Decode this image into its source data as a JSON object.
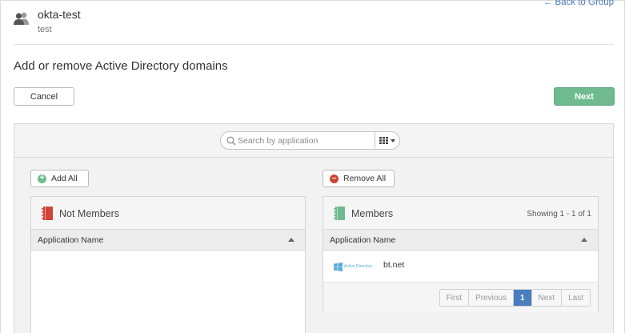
{
  "header": {
    "back_link": "← Back to Group",
    "group_name": "okta-test",
    "group_description": "test",
    "group_icon": "group-icon"
  },
  "page": {
    "title": "Add or remove Active Directory domains"
  },
  "buttons": {
    "cancel": "Cancel",
    "next": "Next"
  },
  "search": {
    "placeholder": "Search by application",
    "value": "",
    "view_toggle_icon": "grid-view-icon"
  },
  "actions": {
    "add_all": "Add All",
    "remove_all": "Remove All"
  },
  "not_members": {
    "title": "Not Members",
    "icon": "app-book-icon",
    "icon_color": "#d04437",
    "columns": [
      "Application Name"
    ],
    "rows": []
  },
  "members": {
    "title": "Members",
    "icon": "app-book-icon",
    "icon_color": "#6fba8e",
    "showing": "Showing 1 - 1 of 1",
    "columns": [
      "Application Name"
    ],
    "rows": [
      {
        "logo": "Active Directory",
        "name": "bt.net"
      }
    ]
  },
  "pagination": {
    "first": "First",
    "previous": "Previous",
    "current": "1",
    "next": "Next",
    "last": "Last"
  },
  "colors": {
    "accent_green": "#6fba8e",
    "remove_red": "#d04437",
    "link_blue": "#4a79b5",
    "active_page": "#4a7cc0"
  }
}
